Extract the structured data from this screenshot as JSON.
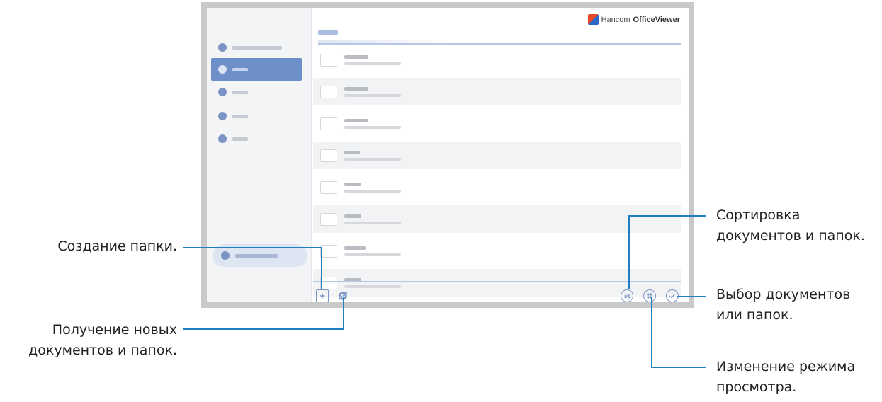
{
  "app": {
    "brand_prefix": "Hancom",
    "brand_bold": "OfficeViewer"
  },
  "sidebar": {
    "items": [
      {
        "icon": "recent-documents-icon",
        "active": false
      },
      {
        "icon": "device-folder-icon",
        "active": true
      },
      {
        "icon": "cloud-icon",
        "active": false
      },
      {
        "icon": "network-icon",
        "active": false
      },
      {
        "icon": "other-icon",
        "active": false
      }
    ],
    "bottom_icon": "office-update-icon"
  },
  "file_list": {
    "rows": 8
  },
  "toolbar": {
    "left_icons": [
      "new-folder-icon",
      "refresh-icon"
    ],
    "right_icons": [
      "sort-icon",
      "view-mode-icon",
      "select-icon"
    ]
  },
  "callouts": {
    "create_folder": "Создание папки.",
    "refresh_line1": "Получение новых",
    "refresh_line2": "документов и папок.",
    "sort_line1": "Сортировка",
    "sort_line2": "документов и папок.",
    "select_line1": "Выбор документов",
    "select_line2": "или папок.",
    "view_line1": "Изменение режима",
    "view_line2": "просмотра."
  },
  "colors": {
    "accent": "#1f7fc0",
    "sidebar_active": "#6f8fc9",
    "toolbar_icon": "#7c95c6"
  }
}
